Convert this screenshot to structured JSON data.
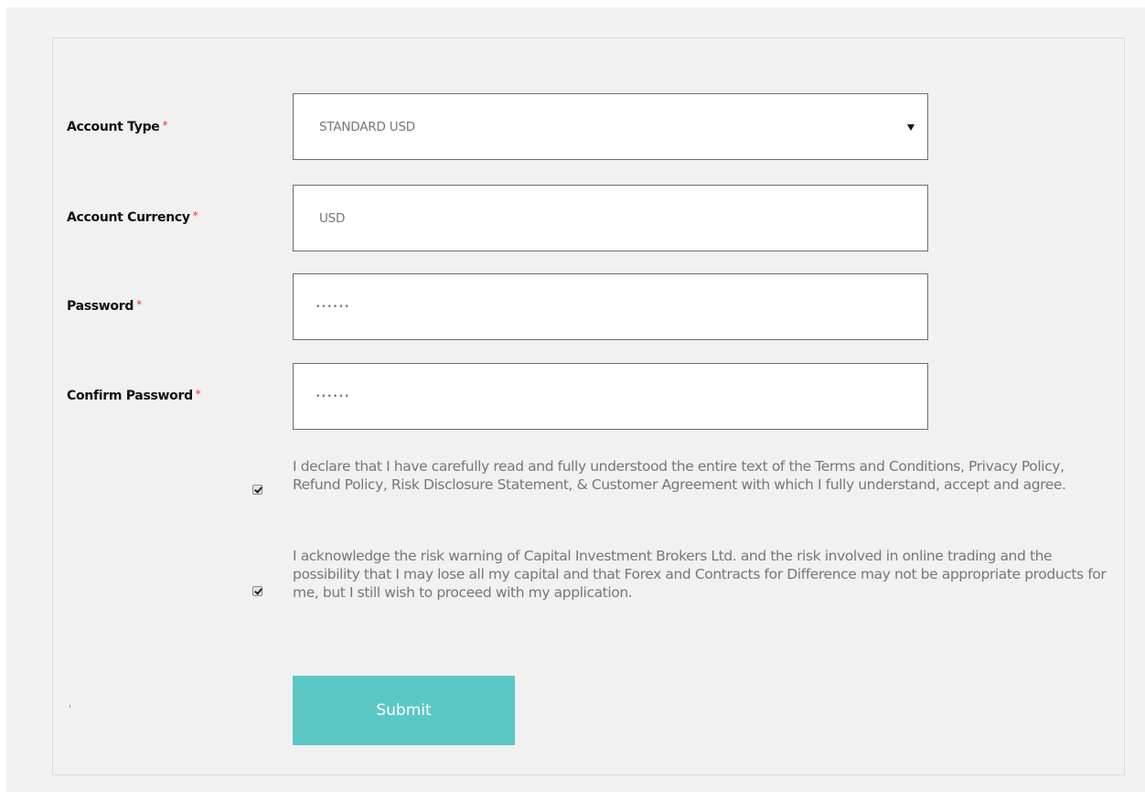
{
  "form": {
    "required_marker": "*",
    "account_type": {
      "label": "Account Type",
      "selected": "STANDARD USD"
    },
    "account_currency": {
      "label": "Account Currency",
      "value": "USD"
    },
    "password": {
      "label": "Password",
      "masked_value": "••••••"
    },
    "confirm_password": {
      "label": "Confirm Password",
      "masked_value": "••••••"
    },
    "consents": [
      {
        "checked": true,
        "text": "I declare that I have carefully read and fully understood the entire text of the Terms and Conditions, Privacy Policy, Refund Policy, Risk Disclosure Statement, & Customer Agreement with which I fully understand, accept and agree."
      },
      {
        "checked": true,
        "text": "I acknowledge the risk warning of Capital Investment Brokers Ltd. and the risk involved in online trading and the possibility that I may lose all my capital and that Forex and Contracts for Difference may not be appropriate products for me, but I still wish to proceed with my application."
      }
    ],
    "submit_label": "Submit",
    "stray_mark": "'"
  },
  "colors": {
    "accent_button": "#5cc8c6",
    "required_marker": "#e53935",
    "panel_background": "#f1f1f1",
    "field_border": "#6d6d6d"
  },
  "icons": {
    "select_arrow": "triangle-down-icon",
    "checkbox_tick": "checkmark-icon"
  }
}
